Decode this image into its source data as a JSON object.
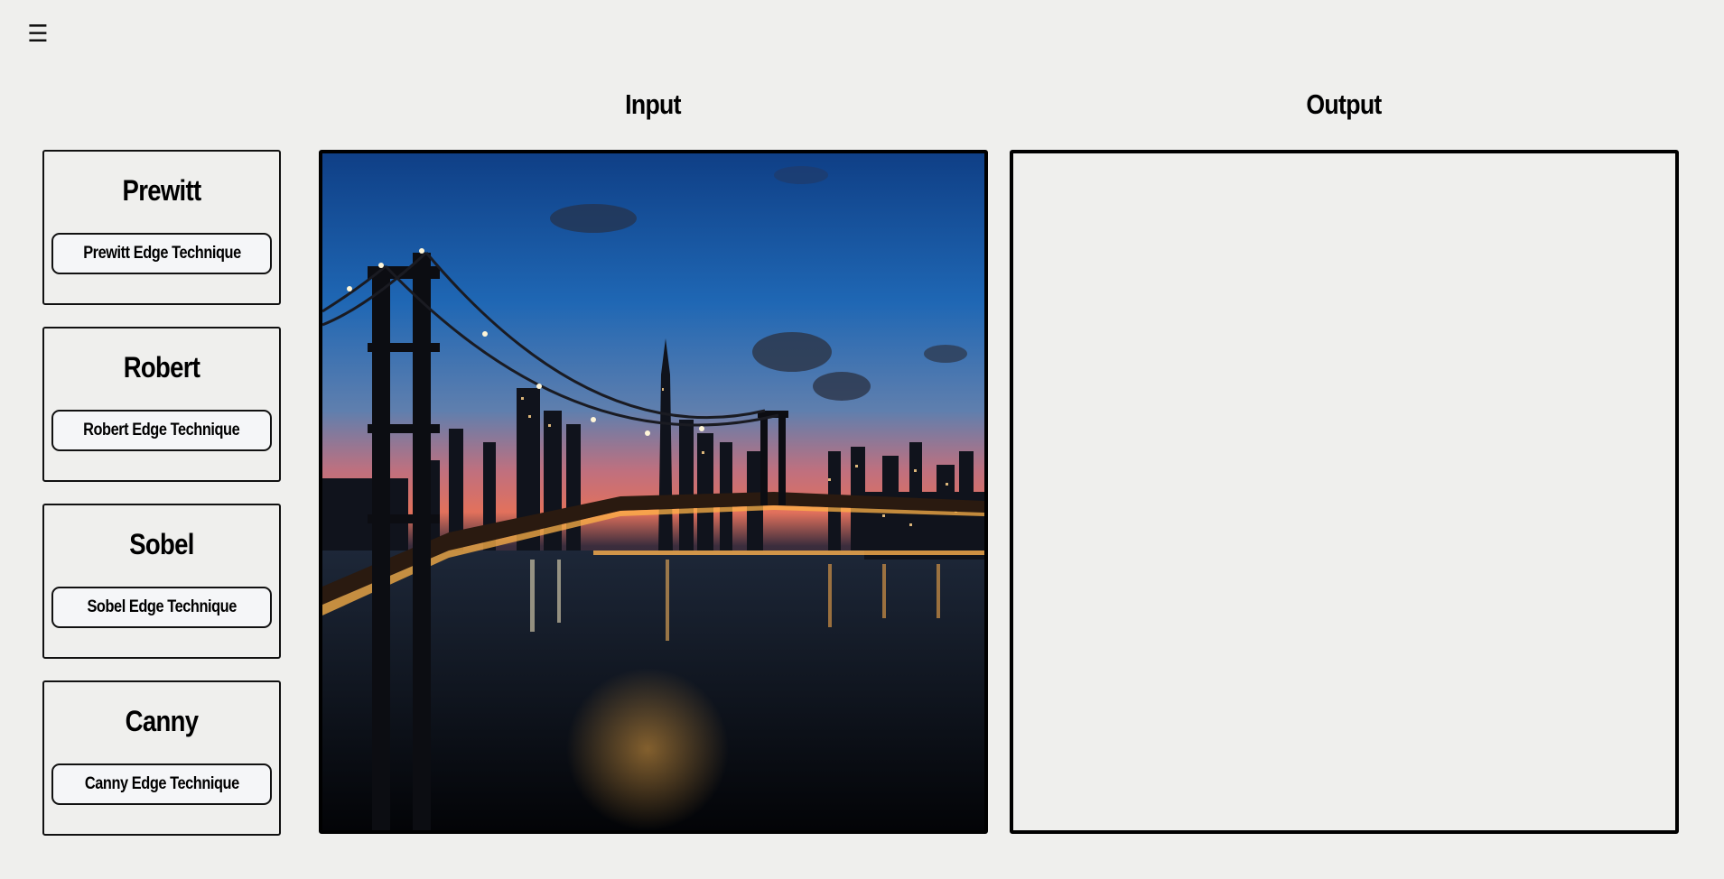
{
  "header": {
    "menu_icon": "☰"
  },
  "panels": {
    "input_title": "Input",
    "output_title": "Output"
  },
  "techniques": [
    {
      "name": "Prewitt",
      "button_label": "Prewitt Edge Technique"
    },
    {
      "name": "Robert",
      "button_label": "Robert Edge Technique"
    },
    {
      "name": "Sobel",
      "button_label": "Sobel Edge Technique"
    },
    {
      "name": "Canny",
      "button_label": "Canny Edge Technique"
    }
  ],
  "input_image": {
    "subject": "bridge-city-night-photo"
  },
  "colors": {
    "background": "#efefed",
    "border": "#000000",
    "button_fill": "#f5f6f8"
  }
}
